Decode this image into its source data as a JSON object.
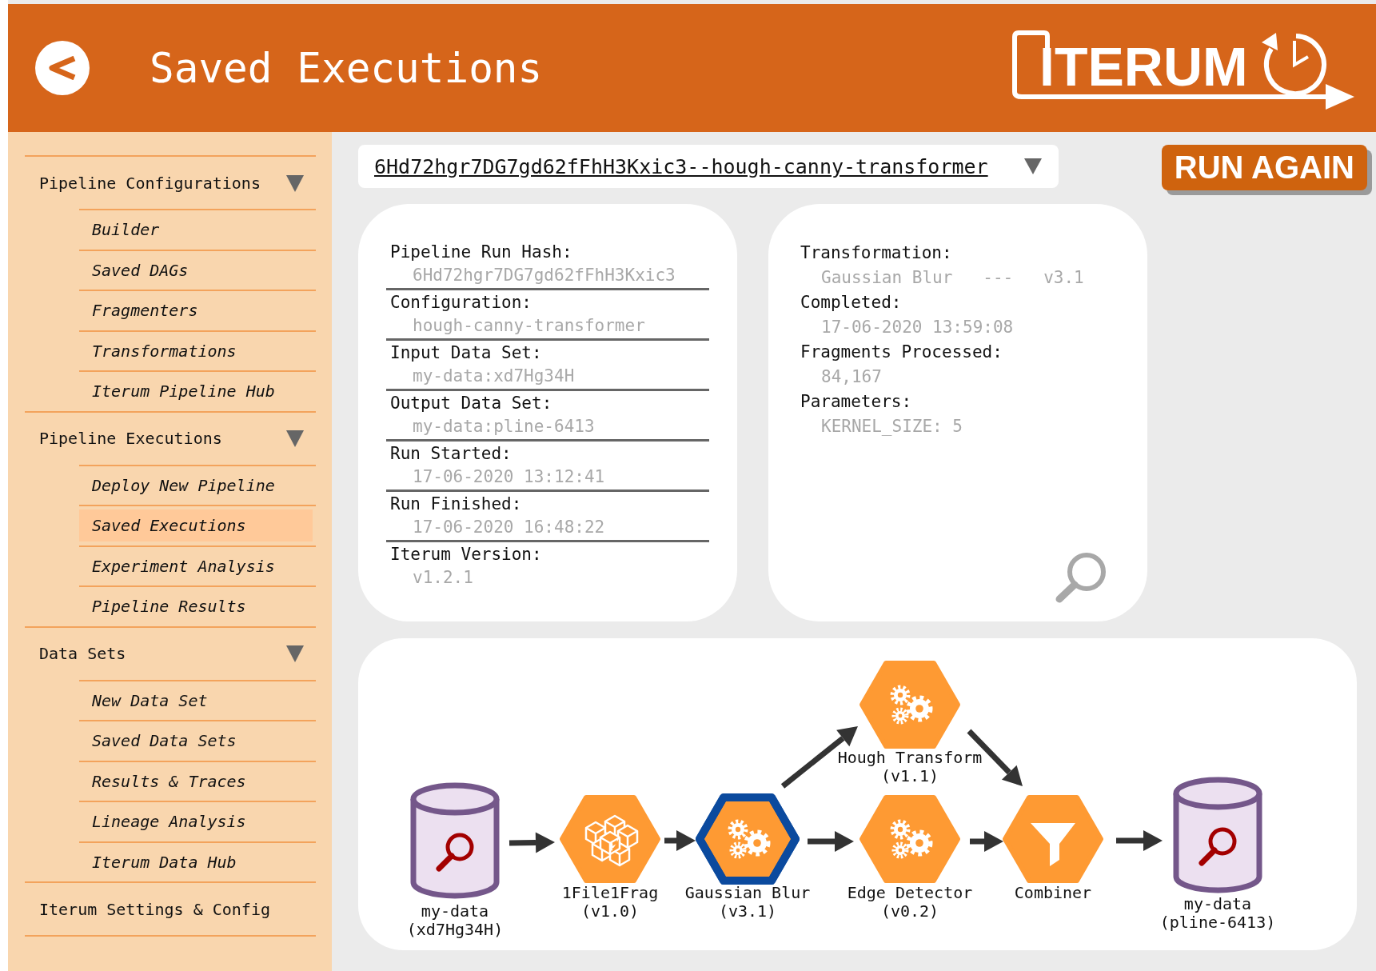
{
  "header": {
    "title": "Saved Executions",
    "logo": "ITERUM"
  },
  "sidebar": {
    "sections": [
      {
        "kind": "group",
        "label": "Pipeline Configurations",
        "expanded": true,
        "items": [
          {
            "label": "Builder",
            "selected": false
          },
          {
            "label": "Saved DAGs",
            "selected": false
          },
          {
            "label": "Fragmenters",
            "selected": false
          },
          {
            "label": "Transformations",
            "selected": false
          },
          {
            "label": "Iterum Pipeline Hub",
            "selected": false
          }
        ]
      },
      {
        "kind": "group",
        "label": "Pipeline Executions",
        "expanded": true,
        "items": [
          {
            "label": "Deploy New Pipeline",
            "selected": false
          },
          {
            "label": "Saved Executions",
            "selected": true
          },
          {
            "label": "Experiment Analysis",
            "selected": false
          },
          {
            "label": "Pipeline Results",
            "selected": false
          }
        ]
      },
      {
        "kind": "group",
        "label": "Data Sets",
        "expanded": true,
        "items": [
          {
            "label": "New Data Set",
            "selected": false
          },
          {
            "label": "Saved Data Sets",
            "selected": false
          },
          {
            "label": "Results & Traces",
            "selected": false
          },
          {
            "label": "Lineage Analysis",
            "selected": false
          },
          {
            "label": "Iterum Data Hub",
            "selected": false
          }
        ]
      },
      {
        "kind": "link",
        "label": "Iterum Settings & Config"
      }
    ]
  },
  "run_selector": {
    "value": "6Hd72hgr7DG7gd62fFhH3Kxic3--hough-canny-transformer"
  },
  "run_again_button": {
    "label": "RUN AGAIN"
  },
  "run_details": [
    {
      "label": "Pipeline Run Hash:",
      "value": "6Hd72hgr7DG7gd62fFhH3Kxic3"
    },
    {
      "label": "Configuration:",
      "value": "hough-canny-transformer"
    },
    {
      "label": "Input Data Set:",
      "value": "my-data:xd7Hg34H"
    },
    {
      "label": "Output Data Set:",
      "value": "my-data:pline-6413"
    },
    {
      "label": "Run Started:",
      "value": "17-06-2020 13:12:41"
    },
    {
      "label": "Run Finished:",
      "value": "17-06-2020 16:48:22"
    },
    {
      "label": "Iterum Version:",
      "value": "v1.2.1"
    }
  ],
  "node_details": [
    {
      "label": "Transformation:",
      "value": "Gaussian Blur   ---   v3.1"
    },
    {
      "label": "Completed:",
      "value": "17-06-2020 13:59:08"
    },
    {
      "label": "Fragments Processed:",
      "value": "84,167"
    },
    {
      "label": "Parameters:",
      "value": "KERNEL_SIZE: 5"
    }
  ],
  "pipeline": {
    "nodes": [
      {
        "kind": "dataset",
        "label": "my-data",
        "sublabel": "(xd7Hg34H)",
        "selected": false
      },
      {
        "kind": "fragmenter",
        "label": "1File1Frag",
        "sublabel": "(v1.0)",
        "selected": false
      },
      {
        "kind": "transformation",
        "label": "Gaussian Blur",
        "sublabel": "(v3.1)",
        "selected": true
      },
      {
        "kind": "transformation",
        "label": "Hough Transform",
        "sublabel": "(v1.1)",
        "selected": false
      },
      {
        "kind": "transformation",
        "label": "Edge Detector",
        "sublabel": "(v0.2)",
        "selected": false
      },
      {
        "kind": "combiner",
        "label": "Combiner",
        "selected": false
      },
      {
        "kind": "dataset",
        "label": "my-data",
        "sublabel": "(pline-6413)",
        "selected": false
      }
    ]
  }
}
